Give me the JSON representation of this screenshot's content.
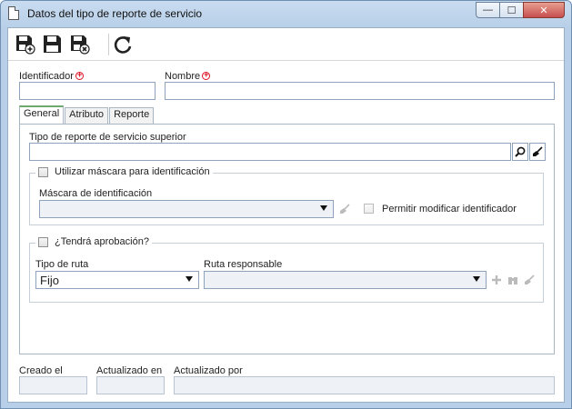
{
  "window": {
    "title": "Datos del tipo de reporte de servicio",
    "minimize": "—",
    "maximize": "☐",
    "close": "✕"
  },
  "toolbar": {
    "buttons": [
      "save-new-icon",
      "save-icon",
      "save-close-icon",
      "refresh-icon"
    ]
  },
  "form": {
    "identificador_label": "Identificador",
    "identificador_value": "",
    "nombre_label": "Nombre",
    "nombre_value": ""
  },
  "tabs": [
    "General",
    "Atributo",
    "Reporte"
  ],
  "general": {
    "tipo_superior_label": "Tipo de reporte de servicio superior",
    "tipo_superior_value": "",
    "mascara_group_label": "Utilizar máscara para identificación",
    "mascara_label": "Máscara de identificación",
    "mascara_value": "",
    "permitir_label": "Permitir modificar identificador",
    "aprobacion_group_label": "¿Tendrá aprobación?",
    "tipo_ruta_label": "Tipo de ruta",
    "tipo_ruta_value": "Fijo",
    "ruta_responsable_label": "Ruta responsable",
    "ruta_responsable_value": ""
  },
  "footer": {
    "creado_label": "Creado el",
    "actualizado_en_label": "Actualizado en",
    "actualizado_por_label": "Actualizado por"
  },
  "colors": {
    "required": "#dd1122",
    "active_tab": "#6da86d",
    "titlebar": "#c9dcf0"
  }
}
